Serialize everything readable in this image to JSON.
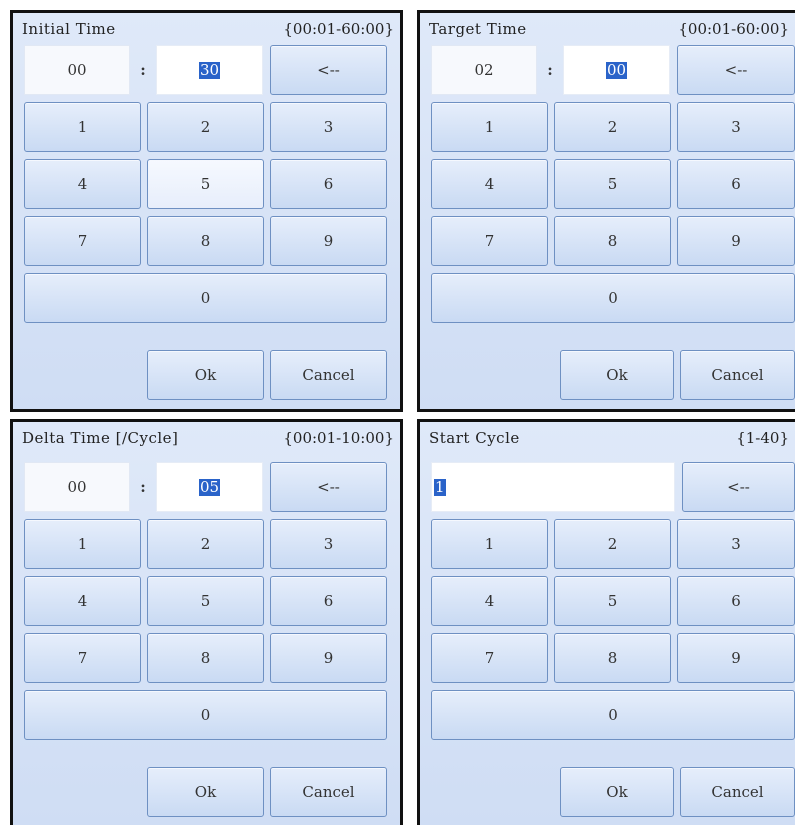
{
  "panels": {
    "initial": {
      "title": "Initial Time",
      "range": "{00:01-60:00}",
      "minutes": "00",
      "separator": ":",
      "seconds": "30",
      "backspace": "<--",
      "keys": [
        "1",
        "2",
        "3",
        "4",
        "5",
        "6",
        "7",
        "8",
        "9",
        "0"
      ],
      "ok": "Ok",
      "cancel": "Cancel"
    },
    "target": {
      "title": "Target Time",
      "range": "{00:01-60:00}",
      "minutes": "02",
      "separator": ":",
      "seconds": "00",
      "backspace": "<--",
      "keys": [
        "1",
        "2",
        "3",
        "4",
        "5",
        "6",
        "7",
        "8",
        "9",
        "0"
      ],
      "ok": "Ok",
      "cancel": "Cancel"
    },
    "delta": {
      "title": "Delta Time [/Cycle]",
      "range": "{00:01-10:00}",
      "minutes": "00",
      "separator": ":",
      "seconds": "05",
      "backspace": "<--",
      "keys": [
        "1",
        "2",
        "3",
        "4",
        "5",
        "6",
        "7",
        "8",
        "9",
        "0"
      ],
      "ok": "Ok",
      "cancel": "Cancel"
    },
    "start": {
      "title": "Start Cycle",
      "range": "{1-40}",
      "value": "1",
      "backspace": "<--",
      "keys": [
        "1",
        "2",
        "3",
        "4",
        "5",
        "6",
        "7",
        "8",
        "9",
        "0"
      ],
      "ok": "Ok",
      "cancel": "Cancel"
    }
  },
  "colors": {
    "panel_bg": "#d7e3f7",
    "key_border": "#6e90c2",
    "selection": "#2a63c9",
    "frame": "#111111"
  },
  "icons": {
    "backspace": "backspace-arrow-text"
  }
}
